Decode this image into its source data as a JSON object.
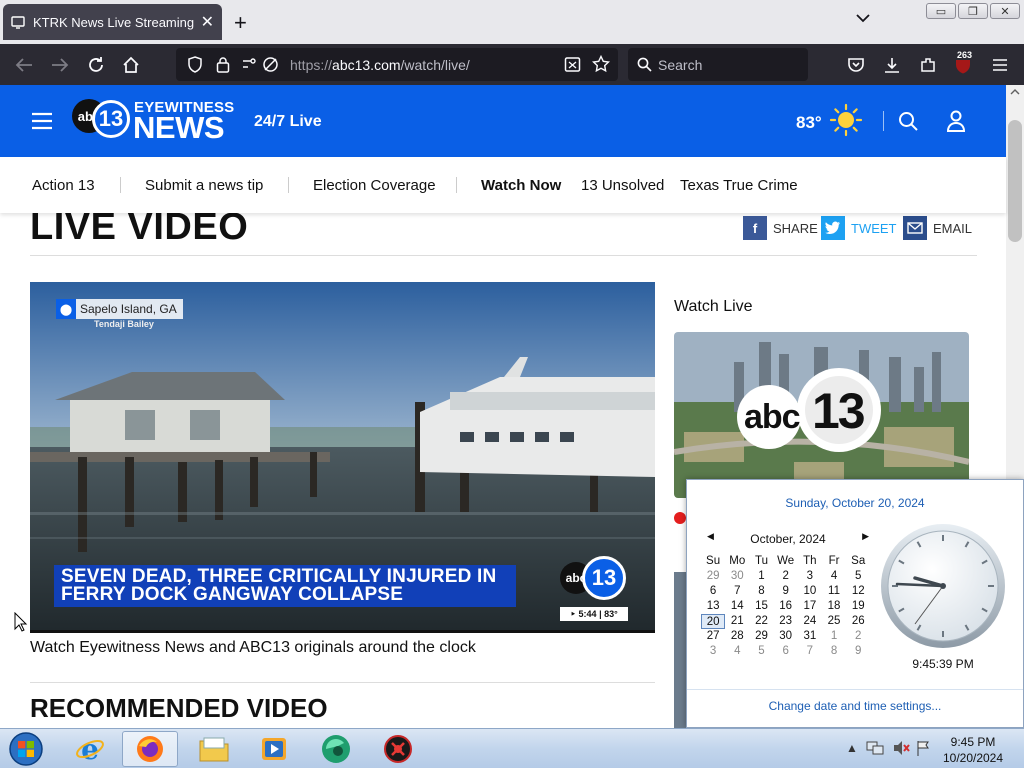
{
  "browser": {
    "tab_title": "KTRK News Live Streaming Vide",
    "tab_close": "✕",
    "new_tab": "+",
    "url_prefix": "https://",
    "url_host": "abc13.com",
    "url_path": "/watch/live/",
    "search_placeholder": "Search",
    "extension_badge": "263",
    "window_min": "▭",
    "window_restore": "❐",
    "window_close": "✕"
  },
  "site": {
    "logo_abc": "abc",
    "logo_13": "13",
    "logo_eyewitness": "EYEWITNESS",
    "logo_news": "NEWS",
    "live_label": "24/7 Live",
    "temperature": "83°",
    "icons": {
      "weather": "sun-icon",
      "search": "search-icon",
      "account": "user-icon",
      "menu": "hamburger-icon"
    }
  },
  "subnav": {
    "items": [
      "Action 13",
      "Submit a news tip",
      "Election Coverage",
      "Watch Now",
      "13 Unsolved",
      "Texas True Crime"
    ]
  },
  "page": {
    "title": "LIVE VIDEO",
    "share": {
      "facebook": "SHARE",
      "twitter": "TWEET",
      "email": "EMAIL"
    },
    "player": {
      "location": "Sapelo Island, GA",
      "reporter": "Tendaji Bailey",
      "headline_line1": "SEVEN DEAD, THREE CRITICALLY INJURED IN",
      "headline_line2": "FERRY DOCK GANGWAY COLLAPSE",
      "bug_abc": "abc",
      "bug_13": "13",
      "time_temp": "‣ 5:44 | 83°"
    },
    "caption": "Watch Eyewitness News and ABC13 originals around the clock",
    "recommended_title": "RECOMMENDED VIDEO",
    "watch_live_title": "Watch Live",
    "thumb_abc": "abc",
    "thumb_13": "13"
  },
  "clock_popup": {
    "long_date": "Sunday, October 20, 2024",
    "month_label": "October, 2024",
    "weekdays": [
      "Su",
      "Mo",
      "Tu",
      "We",
      "Th",
      "Fr",
      "Sa"
    ],
    "weeks": [
      [
        "29",
        "30",
        "1",
        "2",
        "3",
        "4",
        "5"
      ],
      [
        "6",
        "7",
        "8",
        "9",
        "10",
        "11",
        "12"
      ],
      [
        "13",
        "14",
        "15",
        "16",
        "17",
        "18",
        "19"
      ],
      [
        "20",
        "21",
        "22",
        "23",
        "24",
        "25",
        "26"
      ],
      [
        "27",
        "28",
        "29",
        "30",
        "31",
        "1",
        "2"
      ],
      [
        "3",
        "4",
        "5",
        "6",
        "7",
        "8",
        "9"
      ]
    ],
    "selected_day": "20",
    "time": "9:45:39 PM",
    "settings_link": "Change date and time settings..."
  },
  "taskbar": {
    "time": "9:45 PM",
    "date": "10/20/2024",
    "apps": [
      "start-orb-icon",
      "internet-explorer-icon",
      "firefox-icon",
      "explorer-folder-icon",
      "media-player-icon",
      "app-green-icon",
      "app-red-icon"
    ]
  }
}
